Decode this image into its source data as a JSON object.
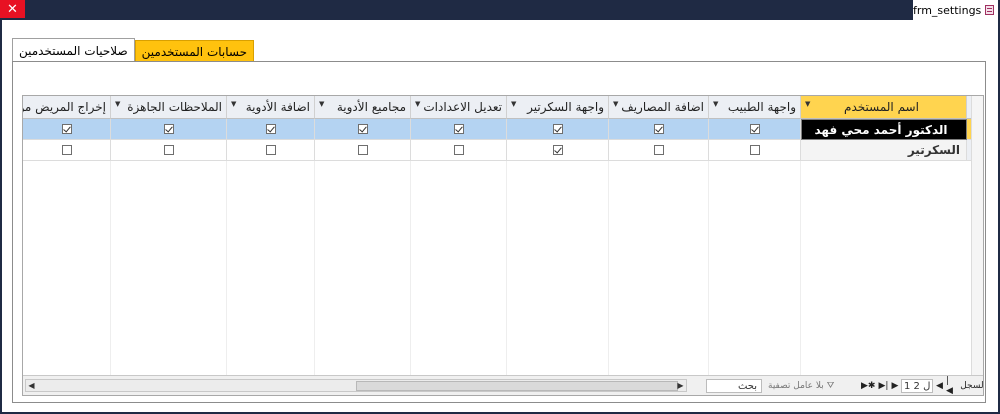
{
  "window": {
    "title": "frm_settings",
    "close_glyph": "✕"
  },
  "tabs": [
    {
      "label": "صلاحيات المستخدمين",
      "active": true
    },
    {
      "label": "حسابات المستخدمين",
      "active": false
    }
  ],
  "columns": [
    "اسم المستخدم",
    "واجهة الطبيب",
    "اضافة المصاريف",
    "واجهة السكرتير",
    "تعديل الاعدادات",
    "مجاميع الأدوية",
    "اضافة الأدوية",
    "الملاحظات الجاهزة",
    "إخراج المريض من"
  ],
  "rows": [
    {
      "name": "الدكتور أحمد محي فهد",
      "values": [
        true,
        true,
        true,
        true,
        true,
        true,
        true,
        true
      ]
    },
    {
      "name": "السكرتير",
      "values": [
        false,
        false,
        true,
        false,
        false,
        false,
        false,
        false
      ]
    }
  ],
  "navigation": {
    "record_label": "السجل:",
    "record_value": "1 ل 2",
    "filter_label": "بلا عامل تصفية",
    "search_label": "بحث"
  },
  "colors": {
    "accent_tab": "#ffc20e",
    "selected_row": "#b4d3f2",
    "header_active": "#ffd44f",
    "frame": "#1f2a44"
  },
  "icons": [
    "close-icon",
    "form-icon",
    "dropdown-arrow-icon",
    "checkbox-icon",
    "filter-icon",
    "nav-first-icon",
    "nav-prev-icon",
    "nav-next-icon",
    "nav-last-icon",
    "nav-new-icon"
  ]
}
